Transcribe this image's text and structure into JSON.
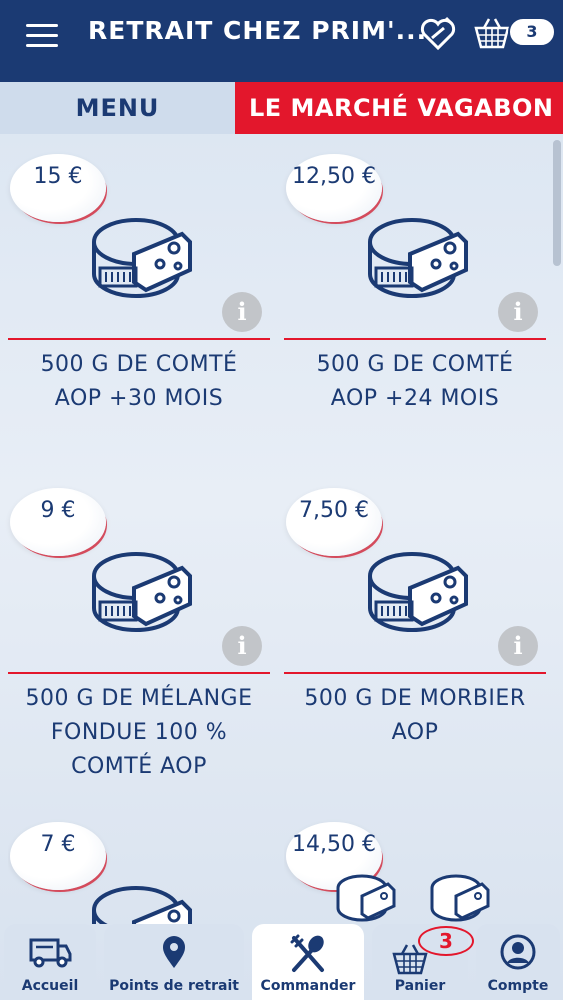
{
  "header": {
    "title": "RETRAIT CHEZ PRIM'...",
    "cart_count": "3",
    "icons": [
      "menu-icon",
      "favorite-store-icon",
      "basket-icon"
    ]
  },
  "tabs": {
    "menu_label": "MENU",
    "market_label": "LE MARCHÉ VAGABON"
  },
  "products": [
    {
      "price": "15 €",
      "name_lines": [
        "500 G DE COMTÉ",
        "AOP +30 MOIS"
      ],
      "icon": "cheese-icon"
    },
    {
      "price": "12,50 €",
      "name_lines": [
        "500 G DE COMTÉ",
        "AOP +24 MOIS"
      ],
      "icon": "cheese-icon"
    },
    {
      "price": "9 €",
      "name_lines": [
        "500 G DE MÉLANGE",
        "FONDUE 100 %",
        "COMTÉ AOP"
      ],
      "icon": "cheese-icon"
    },
    {
      "price": "7,50 €",
      "name_lines": [
        "500 G DE MORBIER",
        "AOP"
      ],
      "icon": "cheese-icon"
    },
    {
      "price": "7 €",
      "name_lines": [],
      "icon": "cheese-icon"
    },
    {
      "price": "14,50 €",
      "name_lines": [],
      "icon": "cheese-icon"
    }
  ],
  "info_glyph": "i",
  "bottom_nav": {
    "items": [
      {
        "label": "Accueil",
        "icon": "truck-icon"
      },
      {
        "label": "Points de retrait",
        "icon": "location-pin-icon"
      },
      {
        "label": "Commander",
        "icon": "fork-spoon-icon"
      },
      {
        "label": "Panier",
        "icon": "basket-icon",
        "badge": "3"
      },
      {
        "label": "Compte",
        "icon": "user-icon"
      }
    ],
    "active": "Commander"
  },
  "colors": {
    "primary": "#1b3a73",
    "accent_red": "#e3172c",
    "background": "#dde6f2"
  }
}
